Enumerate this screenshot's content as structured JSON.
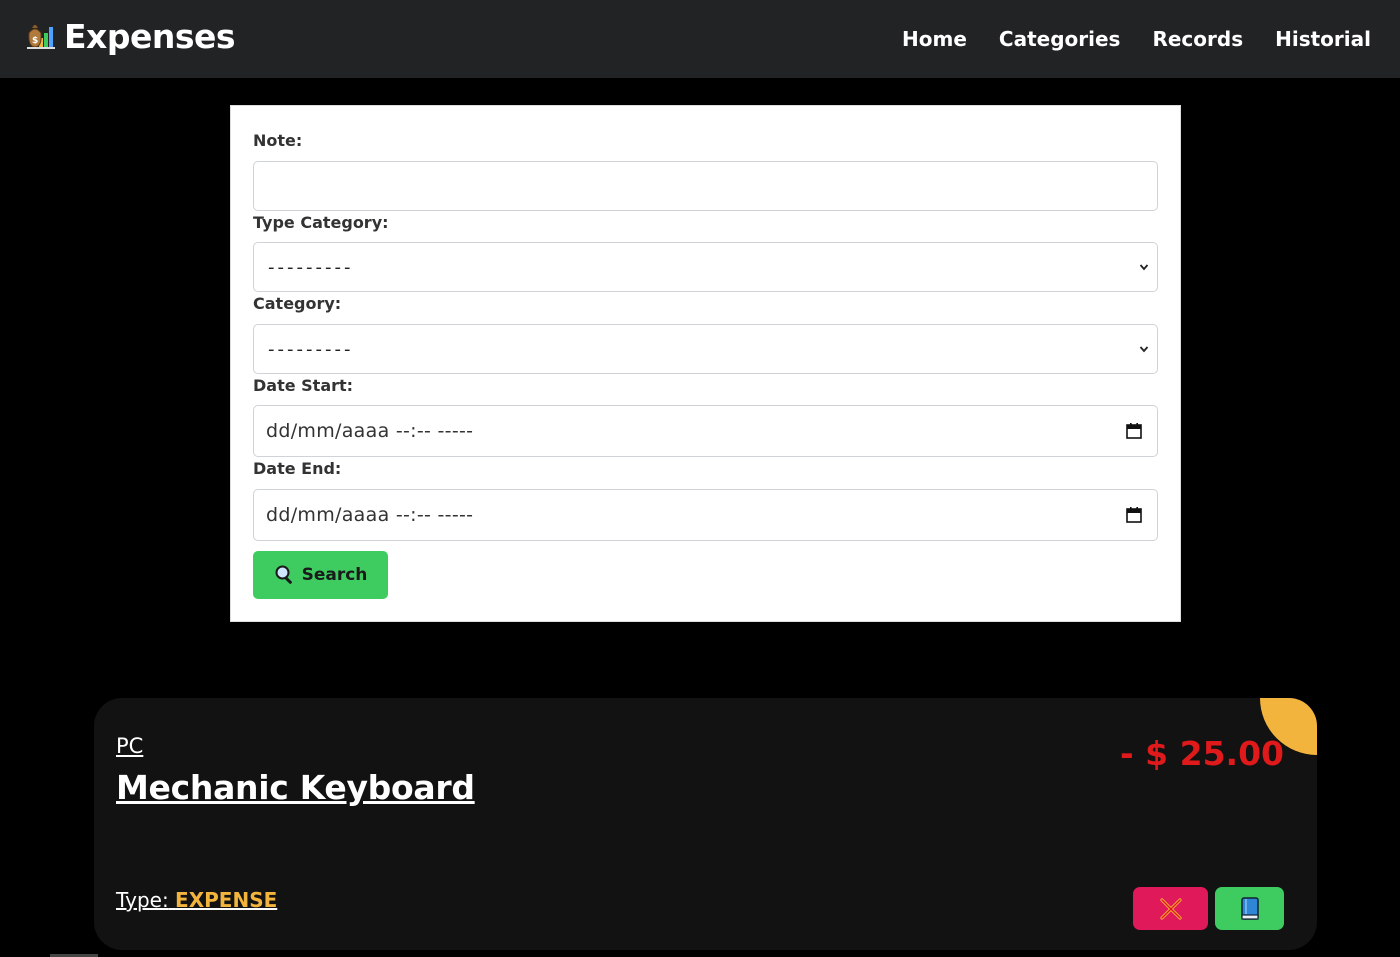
{
  "navbar": {
    "brand": "Expenses",
    "brand_icon": "money-bag-chart-icon",
    "links": [
      "Home",
      "Categories",
      "Records",
      "Historial"
    ]
  },
  "search_form": {
    "note_label": "Note:",
    "note_value": "",
    "type_category_label": "Type Category:",
    "type_category_selected": "---------",
    "category_label": "Category:",
    "category_selected": "---------",
    "date_start_label": "Date Start:",
    "date_start_value": "dd/mm/aaaa --:-- -----",
    "date_end_label": "Date End:",
    "date_end_value": "dd/mm/aaaa --:-- -----",
    "search_button": "Search",
    "search_icon": "magnifier-icon"
  },
  "records": [
    {
      "category": "PC",
      "title": "Mechanic Keyboard",
      "amount": "- $ 25.00",
      "type_label": "Type:",
      "type_value": "EXPENSE",
      "delete_icon": "cross-icon",
      "detail_icon": "book-icon"
    }
  ],
  "colors": {
    "navbar_bg": "#222325",
    "accent_green": "#3ecc61",
    "danger_red": "#e0191b",
    "delete_pink": "#e0195a",
    "expense_orange": "#f2b43d",
    "card_bg": "#121212"
  }
}
